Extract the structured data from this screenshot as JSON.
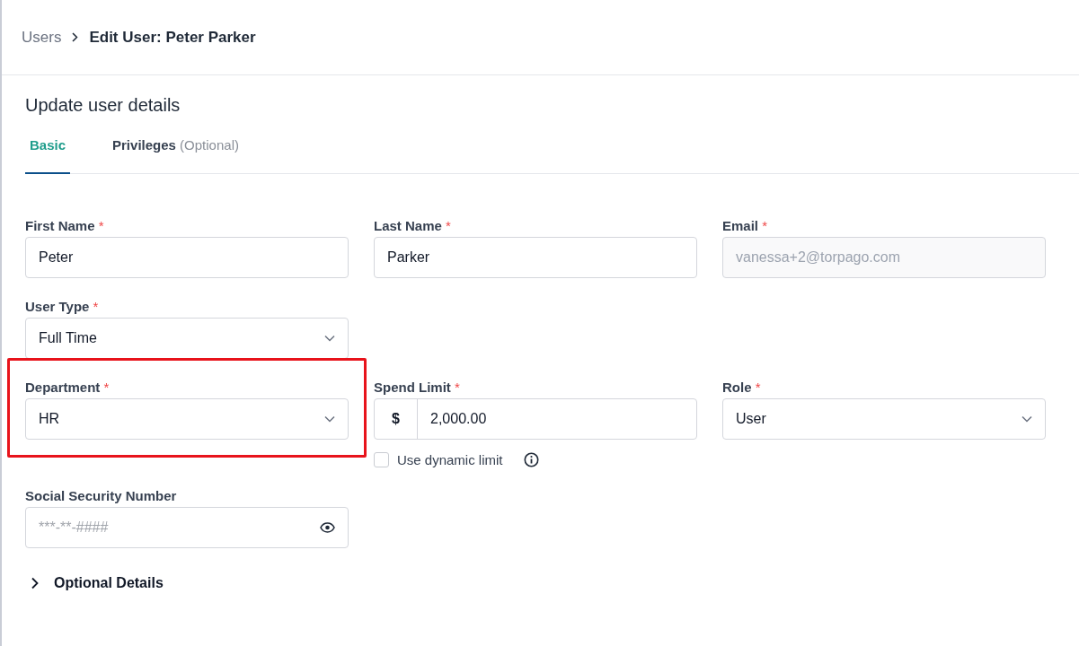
{
  "breadcrumb": {
    "parent": "Users",
    "current": "Edit User: Peter Parker"
  },
  "heading": "Update user details",
  "tabs": [
    {
      "label": "Basic",
      "selected": true
    },
    {
      "label": "Privileges",
      "suffix": "(Optional)",
      "selected": false
    }
  ],
  "rows": [
    {
      "fields": [
        {
          "kind": "text",
          "label": "First Name",
          "required_mark": "*",
          "value": "Peter"
        },
        {
          "kind": "text",
          "label": "Last Name",
          "required_mark": "*",
          "value": "Parker"
        },
        {
          "kind": "text",
          "label": "Email",
          "required_mark": "*",
          "value": "vanessa+2@torpago.com",
          "disabled": true
        }
      ]
    },
    {
      "fields": [
        {
          "kind": "select",
          "label": "User Type",
          "required_mark": "*",
          "value": "Full Time"
        }
      ]
    },
    {
      "fields": [
        {
          "kind": "select",
          "label": "Department",
          "required_mark": "*",
          "value": "HR",
          "highlighted": true
        },
        {
          "kind": "currency",
          "label": "Spend Limit",
          "required_mark": "*",
          "prefix": "$",
          "value": "2,000.00",
          "checkbox": {
            "label": "Use dynamic limit",
            "checked": false
          }
        },
        {
          "kind": "select",
          "label": "Role",
          "required_mark": "*",
          "value": "User"
        }
      ]
    },
    {
      "fields": [
        {
          "kind": "password",
          "label": "Social Security Number",
          "placeholder": "***-**-####"
        }
      ]
    }
  ],
  "optional_section": {
    "label": "Optional Details",
    "expanded": false
  }
}
